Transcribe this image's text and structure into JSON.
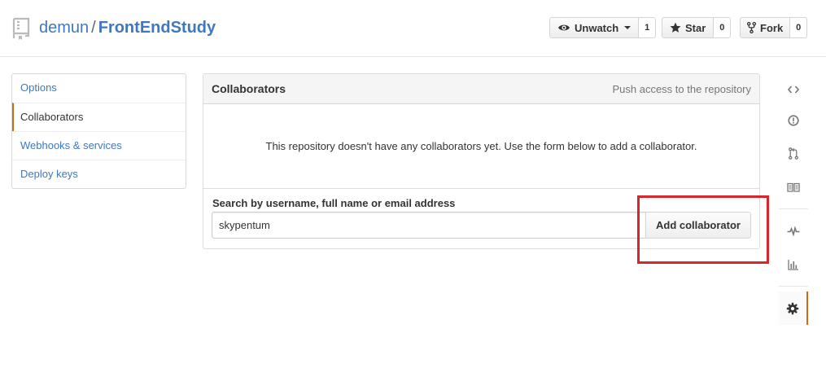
{
  "repo": {
    "owner": "demun",
    "separator": "/",
    "name": "FrontEndStudy"
  },
  "actions": {
    "watch": {
      "label": "Unwatch",
      "count": "1"
    },
    "star": {
      "label": "Star",
      "count": "0"
    },
    "fork": {
      "label": "Fork",
      "count": "0"
    }
  },
  "menu": {
    "items": [
      {
        "label": "Options",
        "selected": false
      },
      {
        "label": "Collaborators",
        "selected": true
      },
      {
        "label": "Webhooks & services",
        "selected": false
      },
      {
        "label": "Deploy keys",
        "selected": false
      }
    ]
  },
  "collaborators": {
    "title": "Collaborators",
    "note": "Push access to the repository",
    "blank_message": "This repository doesn't have any collaborators yet. Use the form below to add a collaborator.",
    "search_label": "Search by username, full name or email address",
    "search_value": "skypentum",
    "add_button": "Add collaborator"
  },
  "colors": {
    "link": "#4078c0",
    "highlight": "#d9252b",
    "selected_accent": "#d26911"
  },
  "sidebar": {
    "icons": [
      "code-icon",
      "issues-icon",
      "pull-request-icon",
      "wiki-icon",
      "pulse-icon",
      "graph-icon",
      "settings-icon"
    ]
  }
}
